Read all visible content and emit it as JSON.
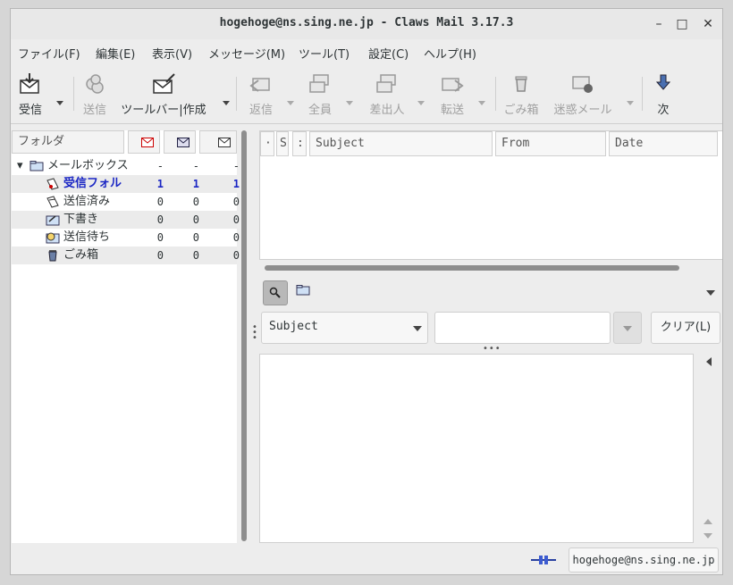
{
  "window": {
    "title": "hogehoge@ns.sing.ne.jp - Claws Mail 3.17.3"
  },
  "menu": [
    "ファイル(F)",
    "編集(E)",
    "表示(V)",
    "メッセージ(M)",
    "ツール(T)",
    "設定(C)",
    "ヘルプ(H)"
  ],
  "toolbar": {
    "receive": "受信",
    "send": "送信",
    "compose": "ツールバー|作成",
    "reply": "返信",
    "reply_all": "全員",
    "reply_sender": "差出人",
    "forward": "転送",
    "trash": "ごみ箱",
    "spam": "迷惑メール",
    "next": "次"
  },
  "folder_pane": {
    "header": "フォルダ",
    "rows": [
      {
        "name": "メールボックス",
        "unread": "-",
        "new": "-",
        "total": "-"
      },
      {
        "name": "受信フォル",
        "unread": "1",
        "new": "1",
        "total": "1"
      },
      {
        "name": "送信済み",
        "unread": "0",
        "new": "0",
        "total": "0"
      },
      {
        "name": "下書き",
        "unread": "0",
        "new": "0",
        "total": "0"
      },
      {
        "name": "送信待ち",
        "unread": "0",
        "new": "0",
        "total": "0"
      },
      {
        "name": "ごみ箱",
        "unread": "0",
        "new": "0",
        "total": "0"
      }
    ]
  },
  "message_list": {
    "col_mark": "·",
    "col_status": "S",
    "col_attach": ":",
    "col_subject": "Subject",
    "col_from": "From",
    "col_date": "Date"
  },
  "quick_search": {
    "field": "Subject",
    "value": "",
    "clear": "クリア(L)"
  },
  "status": {
    "account": "hogehoge@ns.sing.ne.jp"
  },
  "colors": {
    "unread_blue": "#1a26c4",
    "scrollbar": "#8e8e8e"
  }
}
